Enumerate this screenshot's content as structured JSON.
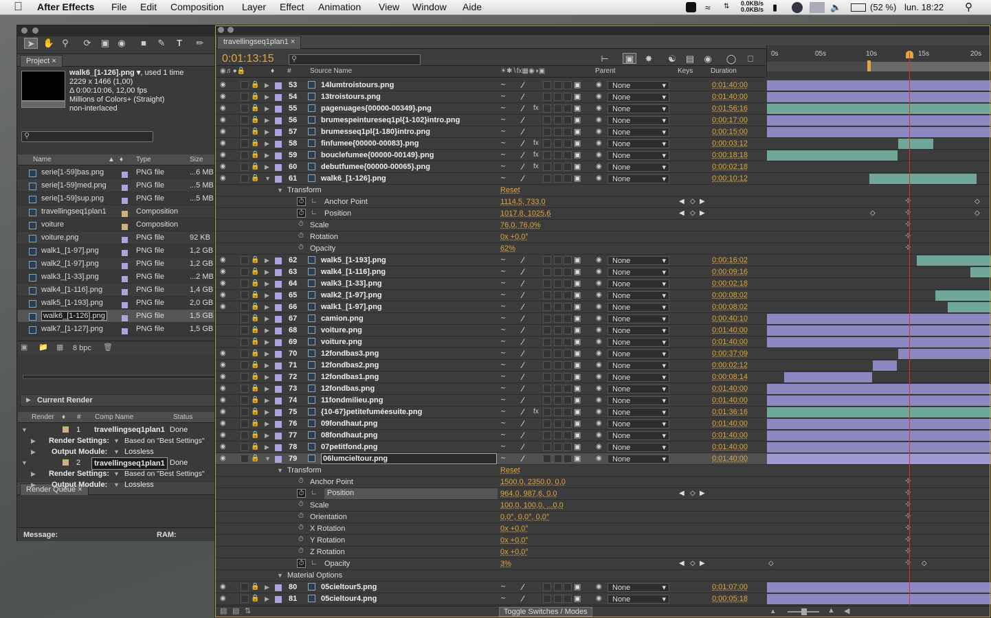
{
  "menubar": {
    "app": "After Effects",
    "items": [
      "File",
      "Edit",
      "Composition",
      "Layer",
      "Effect",
      "Animation",
      "View",
      "Window",
      "Aide"
    ],
    "net_up": "0.0KB/s",
    "net_down": "0.0KB/s",
    "battery": "(52 %)",
    "clock": "lun. 18:22"
  },
  "project": {
    "tab": "Project",
    "file_title": "walk6_[1-126].png ▾",
    "used": ", used 1 time",
    "dims": "2229 x 1466 (1,00)",
    "duration": "Δ 0:00:10:06, 12,00 fps",
    "colors": "Millions of Colors+ (Straight)",
    "interlace": "non-interlaced",
    "columns": {
      "name": "Name",
      "type": "Type",
      "size": "Size"
    },
    "items": [
      {
        "name": "serie[1-59]bas.png",
        "type": "PNG file",
        "size": "...6 MB"
      },
      {
        "name": "serie[1-59]med.png",
        "type": "PNG file",
        "size": "...5 MB"
      },
      {
        "name": "serie[1-59]sup.png",
        "type": "PNG file",
        "size": "...5 MB"
      },
      {
        "name": "travellingseq1plan1",
        "type": "Composition",
        "size": ""
      },
      {
        "name": "voiture",
        "type": "Composition",
        "size": ""
      },
      {
        "name": "voiture.png",
        "type": "PNG file",
        "size": "92 KB"
      },
      {
        "name": "walk1_[1-97].png",
        "type": "PNG file",
        "size": "1,2 GB"
      },
      {
        "name": "walk2_[1-97].png",
        "type": "PNG file",
        "size": "1,2 GB"
      },
      {
        "name": "walk3_[1-33].png",
        "type": "PNG file",
        "size": "...2 MB"
      },
      {
        "name": "walk4_[1-116].png",
        "type": "PNG file",
        "size": "1,4 GB"
      },
      {
        "name": "walk5_[1-193].png",
        "type": "PNG file",
        "size": "2,0 GB"
      },
      {
        "name": "walk6_[1-126].png",
        "type": "PNG file",
        "size": "1,5 GB"
      },
      {
        "name": "walk7_[1-127].png",
        "type": "PNG file",
        "size": "1,5 GB"
      }
    ],
    "bpc": "8 bpc"
  },
  "render": {
    "tab": "Render Queue",
    "current": "Current Render",
    "columns": {
      "render": "Render",
      "num": "#",
      "comp": "Comp Name",
      "status": "Status"
    },
    "rows": [
      {
        "num": "1",
        "comp": "travellingseq1plan1",
        "status": "Done"
      },
      {
        "num": "2",
        "comp": "travellingseq1plan1",
        "status": "Done"
      }
    ],
    "settings_label": "Render Settings:",
    "settings_value": "Based on \"Best Settings\"",
    "output_label": "Output Module:",
    "output_value": "Lossless",
    "message": "Message:",
    "ram": "RAM:"
  },
  "timeline": {
    "tab": "travellingseq1plan1",
    "timecode": "0:01:13:15",
    "columns": {
      "num": "#",
      "source": "Source Name",
      "parent": "Parent",
      "keys": "Keys",
      "duration": "Duration"
    },
    "ruler": [
      "0s",
      "05s",
      "10s",
      "15s",
      "20s"
    ],
    "parent_none": "None",
    "layers_a": [
      {
        "n": "53",
        "name": "14lumtroistours.png",
        "dur": "0:01:40:00"
      },
      {
        "n": "54",
        "name": "13troistours.png",
        "dur": "0:01:40:00"
      },
      {
        "n": "55",
        "name": "pagenuages{00000-00349}.png",
        "dur": "0:01:56:16"
      },
      {
        "n": "56",
        "name": "brumespeintureseq1pl{1-102}intro.png",
        "dur": "0:00:17:00"
      },
      {
        "n": "57",
        "name": "brumesseq1pl{1-180}intro.png",
        "dur": "0:00:15:00"
      },
      {
        "n": "58",
        "name": "finfumee{00000-00083}.png",
        "dur": "0:00:03:12"
      },
      {
        "n": "59",
        "name": "bouclefumee{00000-00149}.png",
        "dur": "0:00:18:18"
      },
      {
        "n": "60",
        "name": "debutfumee{00000-00065}.png",
        "dur": "0:00:02:18"
      },
      {
        "n": "61",
        "name": "walk6_[1-126].png",
        "dur": "0:00:10:12"
      }
    ],
    "transform1": {
      "label": "Transform",
      "reset": "Reset",
      "props": [
        {
          "name": "Anchor Point",
          "value": "1114,5, 733,0"
        },
        {
          "name": "Position",
          "value": "1017,8, 1025,6"
        },
        {
          "name": "Scale",
          "value": "76,0, 76,0%"
        },
        {
          "name": "Rotation",
          "value": "0x +0,0°"
        },
        {
          "name": "Opacity",
          "value": "62%"
        }
      ]
    },
    "layers_b": [
      {
        "n": "62",
        "name": "walk5_[1-193].png",
        "dur": "0:00:16:02"
      },
      {
        "n": "63",
        "name": "walk4_[1-116].png",
        "dur": "0:00:09:16"
      },
      {
        "n": "64",
        "name": "walk3_[1-33].png",
        "dur": "0:00:02:18"
      },
      {
        "n": "65",
        "name": "walk2_[1-97].png",
        "dur": "0:00:08:02"
      },
      {
        "n": "66",
        "name": "walk1_[1-97].png",
        "dur": "0:00:08:02"
      },
      {
        "n": "67",
        "name": "camion.png",
        "dur": "0:00:40:10"
      },
      {
        "n": "68",
        "name": "voiture.png",
        "dur": "0:01:40:00"
      },
      {
        "n": "69",
        "name": "voiture.png",
        "dur": "0:01:40:00"
      },
      {
        "n": "70",
        "name": "12fondbas3.png",
        "dur": "0:00:37:09"
      },
      {
        "n": "71",
        "name": "12fondbas2.png",
        "dur": "0:00:02:12"
      },
      {
        "n": "72",
        "name": "12fondbas1.png",
        "dur": "0:00:08:14"
      },
      {
        "n": "73",
        "name": "12fondbas.png",
        "dur": "0:01:40:00"
      },
      {
        "n": "74",
        "name": "11fondmilieu.png",
        "dur": "0:01:40:00"
      },
      {
        "n": "75",
        "name": "{10-67}petitefuméesuite.png",
        "dur": "0:01:36:16"
      },
      {
        "n": "76",
        "name": "09fondhaut.png",
        "dur": "0:01:40:00"
      },
      {
        "n": "77",
        "name": "08fondhaut.png",
        "dur": "0:01:40:00"
      },
      {
        "n": "78",
        "name": "07petitfond.png",
        "dur": "0:01:40:00"
      },
      {
        "n": "79",
        "name": "06lumcieltour.png",
        "dur": "0:01:40:00"
      }
    ],
    "transform2": {
      "label": "Transform",
      "reset": "Reset",
      "props": [
        {
          "name": "Anchor Point",
          "value": "1500,0, 2350,0, 0,0"
        },
        {
          "name": "Position",
          "value": "964,0, 987,6, 0,0"
        },
        {
          "name": "Scale",
          "value": "100,0, 100,0, ...0,0"
        },
        {
          "name": "Orientation",
          "value": "0,0°, 0,0°, 0,0°"
        },
        {
          "name": "X Rotation",
          "value": "0x +0,0°"
        },
        {
          "name": "Y Rotation",
          "value": "0x +0,0°"
        },
        {
          "name": "Z Rotation",
          "value": "0x +0,0°"
        },
        {
          "name": "Opacity",
          "value": "3%"
        }
      ]
    },
    "material": "Material Options",
    "layers_c": [
      {
        "n": "80",
        "name": "05cieltour5.png",
        "dur": "0:01:07:00"
      },
      {
        "n": "81",
        "name": "05cieltour4.png",
        "dur": "0:00:05:18"
      }
    ],
    "toggle": "Toggle Switches / Modes"
  },
  "colors": {
    "accent": "#e0a640",
    "label_lavender": "#a8a6dc",
    "bar_purple": "#8b88c2",
    "bar_teal": "#6fa79a",
    "playhead": "#e03030"
  }
}
